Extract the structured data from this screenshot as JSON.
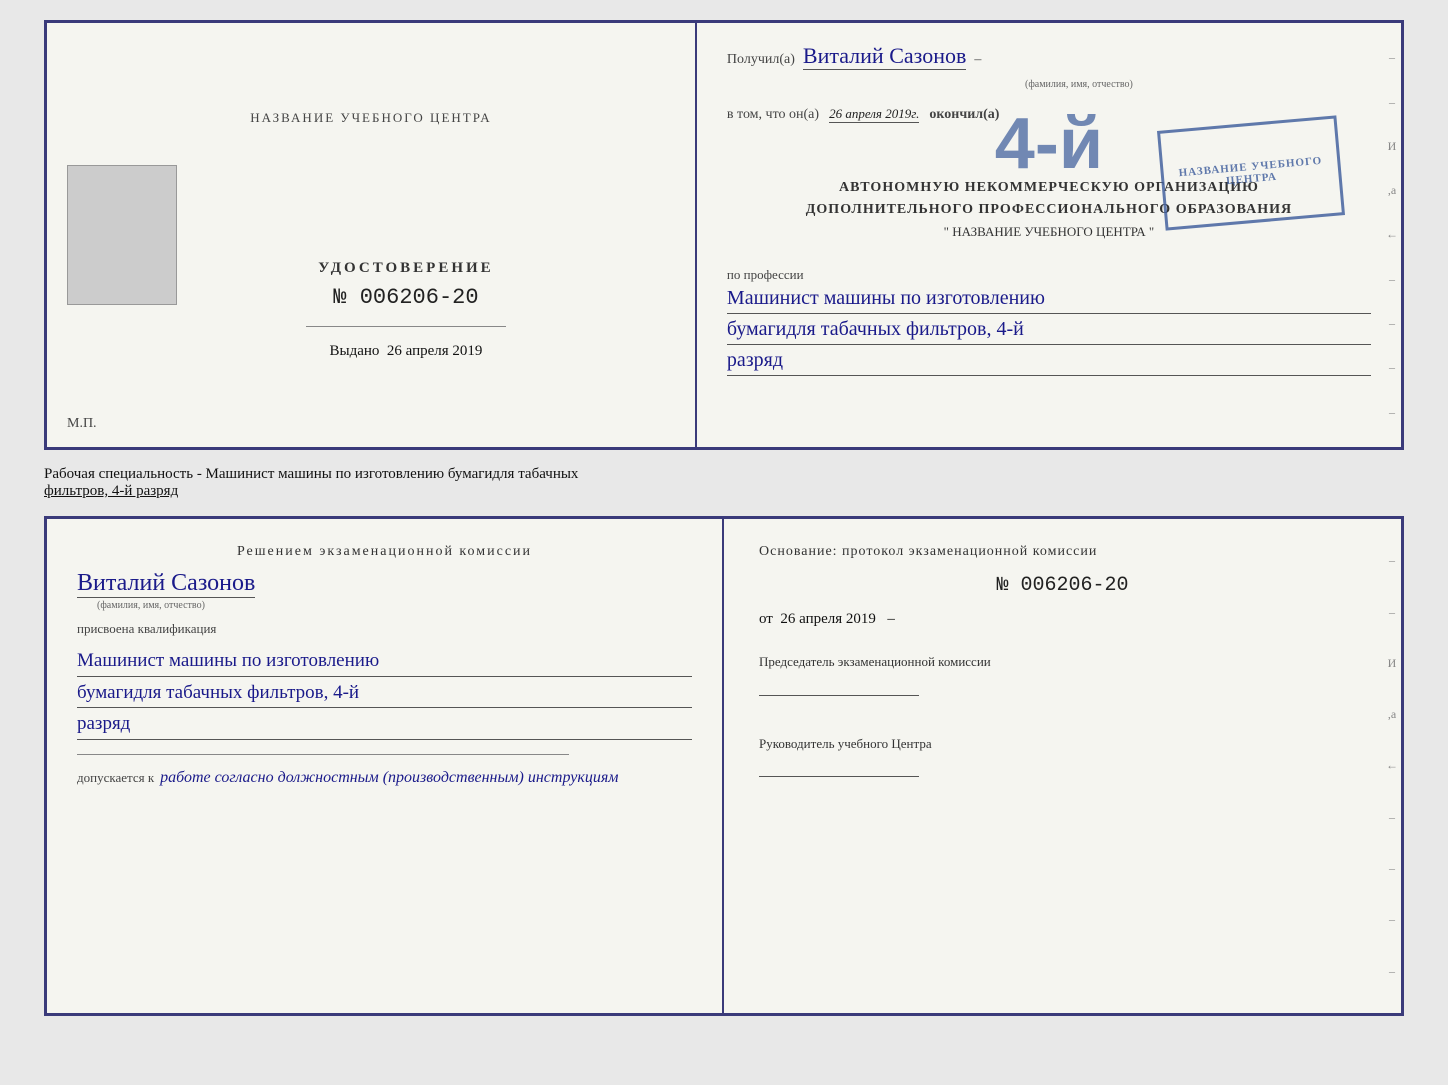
{
  "top_cert": {
    "left": {
      "center_title": "НАЗВАНИЕ УЧЕБНОГО ЦЕНТРА",
      "photo_alt": "фото",
      "main_title": "УДОСТОВЕРЕНИЕ",
      "number": "№ 006206-20",
      "issued_label": "Выдано",
      "issued_date": "26 апреля 2019",
      "mp_label": "М.П."
    },
    "right": {
      "received_label": "Получил(а)",
      "recipient_name": "Виталий Сазонов",
      "recipient_subtitle": "(фамилия, имя, отчество)",
      "in_that_label": "в том, что он(а)",
      "date_value": "26 апреля 2019г.",
      "completed_label": "окончил(а)",
      "org_line1": "АВТОНОМНУЮ НЕКОММЕРЧЕСКУЮ ОРГАНИЗАЦИЮ",
      "org_line2": "ДОПОЛНИТЕЛЬНОГО ПРОФЕССИОНАЛЬНОГО ОБРАЗОВАНИЯ",
      "org_line3": "\" НАЗВАНИЕ УЧЕБНОГО ЦЕНТРА \"",
      "profession_label": "по профессии",
      "profession_text": "Машинист машины по изготовлению",
      "profession_text2": "бумагидля табачных фильтров, 4-й",
      "profession_text3": "разряд",
      "stamp_text": "НАЗВАНИЕ УЧЕБНОГО ЦЕНТРА"
    }
  },
  "middle": {
    "label": "Рабочая специальность - Машинист машины по изготовлению бумагидля табачных",
    "label2": "фильтров, 4-й разряд"
  },
  "bottom_cert": {
    "left": {
      "decision_title": "Решением  экзаменационной  комиссии",
      "person_name": "Виталий Сазонов",
      "person_subtitle": "(фамилия, имя, отчество)",
      "qualification_label": "присвоена квалификация",
      "qualification1": "Машинист машины по изготовлению",
      "qualification2": "бумагидля табачных фильтров, 4-й",
      "qualification3": "разряд",
      "allowed_label": "допускается к",
      "allowed_text": "работе согласно должностным (производственным) инструкциям"
    },
    "right": {
      "basis_label": "Основание: протокол экзаменационной  комиссии",
      "number": "№  006206-20",
      "date_from_label": "от",
      "date_from_value": "26 апреля 2019",
      "chairman_title": "Председатель экзаменационной комиссии",
      "head_title": "Руководитель учебного Центра"
    }
  },
  "side_items": [
    "-",
    "-",
    "И",
    ",а",
    "←",
    "-",
    "-",
    "-",
    "-"
  ],
  "side_items2": [
    "-",
    "-",
    "И",
    ",а",
    "←",
    "-",
    "-",
    "-",
    "-"
  ]
}
